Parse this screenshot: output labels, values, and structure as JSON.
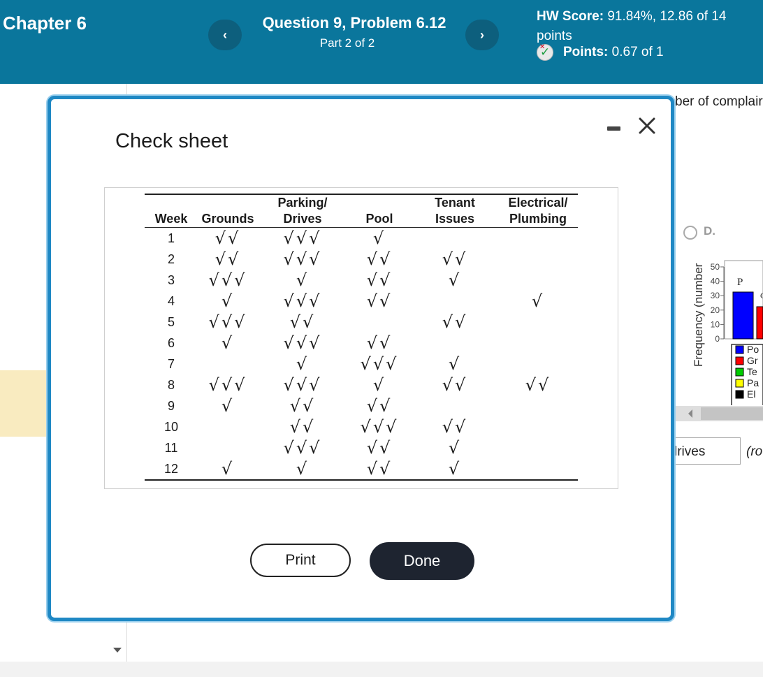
{
  "header": {
    "chapter": "Chapter 6",
    "question_title": "Question 9, Problem 6.12",
    "part": "Part 2 of 2",
    "prev_label": "‹",
    "next_label": "›",
    "hw_score_label": "HW Score:",
    "hw_score_value": "91.84%, 12.86 of 14 points",
    "points_label": "Points:",
    "points_value": "0.67 of 1"
  },
  "background": {
    "question_fragment": "ber of complair",
    "option_label": "D.",
    "chart": {
      "ylabel": "Frequency (number",
      "y_ticks": [
        "50",
        "40",
        "30",
        "20",
        "10",
        "0"
      ],
      "bar_label": "P",
      "bar_label_2": "C",
      "legend": [
        "Po",
        "Gr",
        "Te",
        "Pa",
        "El"
      ],
      "colors": [
        "#0000ff",
        "#ff0000",
        "#00cc00",
        "#ffff00",
        "#000000"
      ]
    },
    "answer_value": "lrives",
    "answer_suffix": "(ro"
  },
  "modal": {
    "title": "Check sheet",
    "table": {
      "headers": [
        [
          "",
          "Week"
        ],
        [
          "",
          "Grounds"
        ],
        [
          "Parking/",
          "Drives"
        ],
        [
          "",
          "Pool"
        ],
        [
          "Tenant",
          "Issues"
        ],
        [
          "Electrical/",
          "Plumbing"
        ]
      ],
      "rows": [
        {
          "week": "1",
          "grounds": "√√",
          "parking": "√√√",
          "pool": "√",
          "tenant": "",
          "electrical": ""
        },
        {
          "week": "2",
          "grounds": "√√",
          "parking": "√√√",
          "pool": "√√",
          "tenant": "√√",
          "electrical": ""
        },
        {
          "week": "3",
          "grounds": "√√√",
          "parking": "√",
          "pool": "√√",
          "tenant": "√",
          "electrical": ""
        },
        {
          "week": "4",
          "grounds": "√",
          "parking": "√√√",
          "pool": "√√",
          "tenant": "",
          "electrical": "√"
        },
        {
          "week": "5",
          "grounds": "√√√",
          "parking": "√√",
          "pool": "",
          "tenant": "√√",
          "electrical": ""
        },
        {
          "week": "6",
          "grounds": "√",
          "parking": "√√√",
          "pool": "√√",
          "tenant": "",
          "electrical": ""
        },
        {
          "week": "7",
          "grounds": "",
          "parking": "√",
          "pool": "√√√",
          "tenant": "√",
          "electrical": ""
        },
        {
          "week": "8",
          "grounds": "√√√",
          "parking": "√√√",
          "pool": "√",
          "tenant": "√√",
          "electrical": "√√"
        },
        {
          "week": "9",
          "grounds": "√",
          "parking": "√√",
          "pool": "√√",
          "tenant": "",
          "electrical": ""
        },
        {
          "week": "10",
          "grounds": "",
          "parking": "√√",
          "pool": "√√√",
          "tenant": "√√",
          "electrical": ""
        },
        {
          "week": "11",
          "grounds": "",
          "parking": "√√√",
          "pool": "√√",
          "tenant": "√",
          "electrical": ""
        },
        {
          "week": "12",
          "grounds": "√",
          "parking": "√",
          "pool": "√√",
          "tenant": "√",
          "electrical": ""
        }
      ]
    },
    "print_label": "Print",
    "done_label": "Done"
  }
}
